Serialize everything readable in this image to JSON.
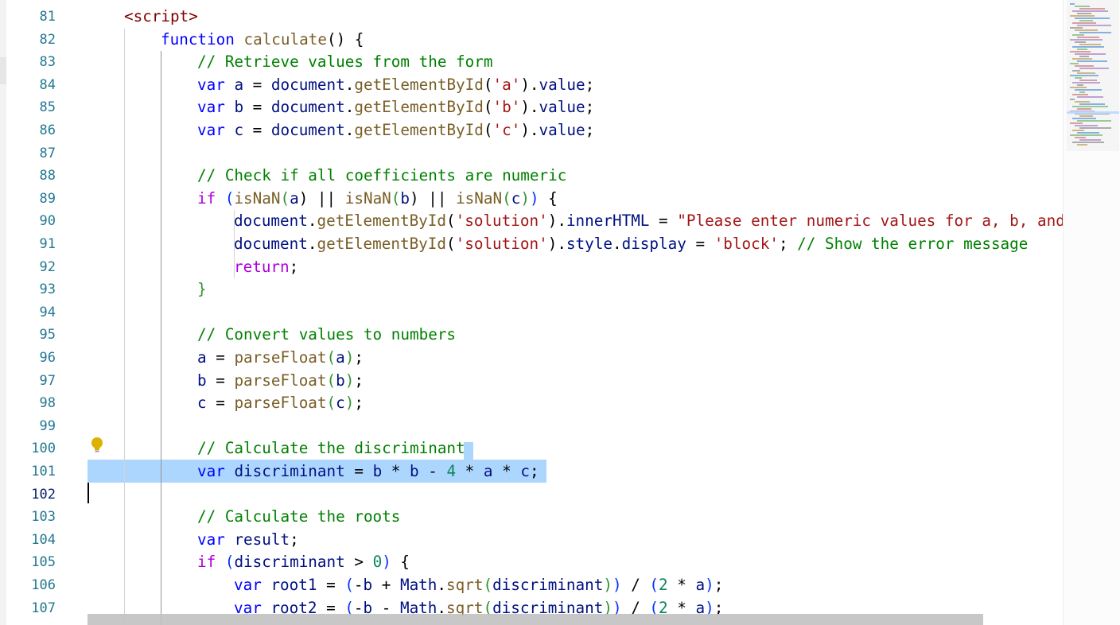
{
  "editor": {
    "active_line": 102,
    "lines": [
      {
        "num": 81,
        "indent": 1,
        "tokens": [
          {
            "t": "<",
            "c": "#800000"
          },
          {
            "t": "script",
            "c": "#800000"
          },
          {
            "t": ">",
            "c": "#800000"
          }
        ]
      },
      {
        "num": 82,
        "indent": 2,
        "tokens": [
          {
            "t": "function ",
            "c": "#0000ff"
          },
          {
            "t": "calculate",
            "c": "#795e26"
          },
          {
            "t": "() {",
            "c": "#000000"
          }
        ]
      },
      {
        "num": 83,
        "indent": 3,
        "tokens": [
          {
            "t": "// Retrieve values from the form",
            "c": "#008000"
          }
        ]
      },
      {
        "num": 84,
        "indent": 3,
        "tokens": [
          {
            "t": "var ",
            "c": "#0000ff"
          },
          {
            "t": "a",
            "c": "#001080"
          },
          {
            "t": " = ",
            "c": "#000000"
          },
          {
            "t": "document",
            "c": "#001080"
          },
          {
            "t": ".",
            "c": "#000000"
          },
          {
            "t": "getElementById",
            "c": "#795e26"
          },
          {
            "t": "(",
            "c": "#000000"
          },
          {
            "t": "'a'",
            "c": "#a31515"
          },
          {
            "t": ").",
            "c": "#000000"
          },
          {
            "t": "value",
            "c": "#001080"
          },
          {
            "t": ";",
            "c": "#000000"
          }
        ]
      },
      {
        "num": 85,
        "indent": 3,
        "tokens": [
          {
            "t": "var ",
            "c": "#0000ff"
          },
          {
            "t": "b",
            "c": "#001080"
          },
          {
            "t": " = ",
            "c": "#000000"
          },
          {
            "t": "document",
            "c": "#001080"
          },
          {
            "t": ".",
            "c": "#000000"
          },
          {
            "t": "getElementById",
            "c": "#795e26"
          },
          {
            "t": "(",
            "c": "#000000"
          },
          {
            "t": "'b'",
            "c": "#a31515"
          },
          {
            "t": ").",
            "c": "#000000"
          },
          {
            "t": "value",
            "c": "#001080"
          },
          {
            "t": ";",
            "c": "#000000"
          }
        ]
      },
      {
        "num": 86,
        "indent": 3,
        "tokens": [
          {
            "t": "var ",
            "c": "#0000ff"
          },
          {
            "t": "c",
            "c": "#001080"
          },
          {
            "t": " = ",
            "c": "#000000"
          },
          {
            "t": "document",
            "c": "#001080"
          },
          {
            "t": ".",
            "c": "#000000"
          },
          {
            "t": "getElementById",
            "c": "#795e26"
          },
          {
            "t": "(",
            "c": "#000000"
          },
          {
            "t": "'c'",
            "c": "#a31515"
          },
          {
            "t": ").",
            "c": "#000000"
          },
          {
            "t": "value",
            "c": "#001080"
          },
          {
            "t": ";",
            "c": "#000000"
          }
        ]
      },
      {
        "num": 87,
        "indent": 3,
        "tokens": []
      },
      {
        "num": 88,
        "indent": 3,
        "tokens": [
          {
            "t": "// Check if all coefficients are numeric",
            "c": "#008000"
          }
        ]
      },
      {
        "num": 89,
        "indent": 3,
        "tokens": [
          {
            "t": "if ",
            "c": "#af00db"
          },
          {
            "t": "(",
            "c": "#0431fa"
          },
          {
            "t": "isNaN",
            "c": "#795e26"
          },
          {
            "t": "(",
            "c": "#319331"
          },
          {
            "t": "a",
            "c": "#001080"
          },
          {
            "t": ") || ",
            "c": "#000000"
          },
          {
            "t": "isNaN",
            "c": "#795e26"
          },
          {
            "t": "(",
            "c": "#319331"
          },
          {
            "t": "b",
            "c": "#001080"
          },
          {
            "t": ") || ",
            "c": "#000000"
          },
          {
            "t": "isNaN",
            "c": "#795e26"
          },
          {
            "t": "(",
            "c": "#319331"
          },
          {
            "t": "c",
            "c": "#001080"
          },
          {
            "t": ")",
            "c": "#319331"
          },
          {
            "t": ")",
            "c": "#0431fa"
          },
          {
            "t": " {",
            "c": "#000000"
          }
        ]
      },
      {
        "num": 90,
        "indent": 4,
        "tokens": [
          {
            "t": "document",
            "c": "#001080"
          },
          {
            "t": ".",
            "c": "#000000"
          },
          {
            "t": "getElementById",
            "c": "#795e26"
          },
          {
            "t": "(",
            "c": "#000000"
          },
          {
            "t": "'solution'",
            "c": "#a31515"
          },
          {
            "t": ").",
            "c": "#000000"
          },
          {
            "t": "innerHTML",
            "c": "#001080"
          },
          {
            "t": " = ",
            "c": "#000000"
          },
          {
            "t": "\"Please enter numeric values for a, b, and",
            "c": "#a31515"
          }
        ]
      },
      {
        "num": 91,
        "indent": 4,
        "tokens": [
          {
            "t": "document",
            "c": "#001080"
          },
          {
            "t": ".",
            "c": "#000000"
          },
          {
            "t": "getElementById",
            "c": "#795e26"
          },
          {
            "t": "(",
            "c": "#000000"
          },
          {
            "t": "'solution'",
            "c": "#a31515"
          },
          {
            "t": ").",
            "c": "#000000"
          },
          {
            "t": "style",
            "c": "#001080"
          },
          {
            "t": ".",
            "c": "#000000"
          },
          {
            "t": "display",
            "c": "#001080"
          },
          {
            "t": " = ",
            "c": "#000000"
          },
          {
            "t": "'block'",
            "c": "#a31515"
          },
          {
            "t": "; ",
            "c": "#000000"
          },
          {
            "t": "// Show the error message",
            "c": "#008000"
          }
        ]
      },
      {
        "num": 92,
        "indent": 4,
        "tokens": [
          {
            "t": "return",
            "c": "#af00db"
          },
          {
            "t": ";",
            "c": "#000000"
          }
        ]
      },
      {
        "num": 93,
        "indent": 3,
        "tokens": [
          {
            "t": "}",
            "c": "#319331"
          }
        ]
      },
      {
        "num": 94,
        "indent": 3,
        "tokens": []
      },
      {
        "num": 95,
        "indent": 3,
        "tokens": [
          {
            "t": "// Convert values to numbers",
            "c": "#008000"
          }
        ]
      },
      {
        "num": 96,
        "indent": 3,
        "tokens": [
          {
            "t": "a",
            "c": "#001080"
          },
          {
            "t": " = ",
            "c": "#000000"
          },
          {
            "t": "parseFloat",
            "c": "#795e26"
          },
          {
            "t": "(",
            "c": "#319331"
          },
          {
            "t": "a",
            "c": "#001080"
          },
          {
            "t": ")",
            "c": "#319331"
          },
          {
            "t": ";",
            "c": "#000000"
          }
        ]
      },
      {
        "num": 97,
        "indent": 3,
        "tokens": [
          {
            "t": "b",
            "c": "#001080"
          },
          {
            "t": " = ",
            "c": "#000000"
          },
          {
            "t": "parseFloat",
            "c": "#795e26"
          },
          {
            "t": "(",
            "c": "#319331"
          },
          {
            "t": "b",
            "c": "#001080"
          },
          {
            "t": ")",
            "c": "#319331"
          },
          {
            "t": ";",
            "c": "#000000"
          }
        ]
      },
      {
        "num": 98,
        "indent": 3,
        "tokens": [
          {
            "t": "c",
            "c": "#001080"
          },
          {
            "t": " = ",
            "c": "#000000"
          },
          {
            "t": "parseFloat",
            "c": "#795e26"
          },
          {
            "t": "(",
            "c": "#319331"
          },
          {
            "t": "c",
            "c": "#001080"
          },
          {
            "t": ")",
            "c": "#319331"
          },
          {
            "t": ";",
            "c": "#000000"
          }
        ]
      },
      {
        "num": 99,
        "indent": 3,
        "tokens": []
      },
      {
        "num": 100,
        "indent": 3,
        "tokens": [
          {
            "t": "// Calculate the discriminant",
            "c": "#008000"
          }
        ]
      },
      {
        "num": 101,
        "indent": 3,
        "tokens": [
          {
            "t": "var ",
            "c": "#0000ff"
          },
          {
            "t": "discriminant",
            "c": "#001080"
          },
          {
            "t": " = ",
            "c": "#000000"
          },
          {
            "t": "b",
            "c": "#001080"
          },
          {
            "t": " * ",
            "c": "#000000"
          },
          {
            "t": "b",
            "c": "#001080"
          },
          {
            "t": " - ",
            "c": "#000000"
          },
          {
            "t": "4",
            "c": "#098658"
          },
          {
            "t": " * ",
            "c": "#000000"
          },
          {
            "t": "a",
            "c": "#001080"
          },
          {
            "t": " * ",
            "c": "#000000"
          },
          {
            "t": "c",
            "c": "#001080"
          },
          {
            "t": ";",
            "c": "#000000"
          }
        ]
      },
      {
        "num": 102,
        "indent": 0,
        "tokens": []
      },
      {
        "num": 103,
        "indent": 3,
        "tokens": [
          {
            "t": "// Calculate the roots",
            "c": "#008000"
          }
        ]
      },
      {
        "num": 104,
        "indent": 3,
        "tokens": [
          {
            "t": "var ",
            "c": "#0000ff"
          },
          {
            "t": "result",
            "c": "#001080"
          },
          {
            "t": ";",
            "c": "#000000"
          }
        ]
      },
      {
        "num": 105,
        "indent": 3,
        "tokens": [
          {
            "t": "if ",
            "c": "#af00db"
          },
          {
            "t": "(",
            "c": "#0431fa"
          },
          {
            "t": "discriminant",
            "c": "#001080"
          },
          {
            "t": " > ",
            "c": "#000000"
          },
          {
            "t": "0",
            "c": "#098658"
          },
          {
            "t": ")",
            "c": "#0431fa"
          },
          {
            "t": " {",
            "c": "#000000"
          }
        ]
      },
      {
        "num": 106,
        "indent": 4,
        "tokens": [
          {
            "t": "var ",
            "c": "#0000ff"
          },
          {
            "t": "root1",
            "c": "#001080"
          },
          {
            "t": " = ",
            "c": "#000000"
          },
          {
            "t": "(",
            "c": "#0431fa"
          },
          {
            "t": "-",
            "c": "#000000"
          },
          {
            "t": "b",
            "c": "#001080"
          },
          {
            "t": " + ",
            "c": "#000000"
          },
          {
            "t": "Math",
            "c": "#001080"
          },
          {
            "t": ".",
            "c": "#000000"
          },
          {
            "t": "sqrt",
            "c": "#795e26"
          },
          {
            "t": "(",
            "c": "#319331"
          },
          {
            "t": "discriminant",
            "c": "#001080"
          },
          {
            "t": ")",
            "c": "#319331"
          },
          {
            "t": ")",
            "c": "#0431fa"
          },
          {
            "t": " / ",
            "c": "#000000"
          },
          {
            "t": "(",
            "c": "#0431fa"
          },
          {
            "t": "2",
            "c": "#098658"
          },
          {
            "t": " * ",
            "c": "#000000"
          },
          {
            "t": "a",
            "c": "#001080"
          },
          {
            "t": ")",
            "c": "#0431fa"
          },
          {
            "t": ";",
            "c": "#000000"
          }
        ]
      },
      {
        "num": 107,
        "indent": 4,
        "tokens": [
          {
            "t": "var ",
            "c": "#0000ff"
          },
          {
            "t": "root2",
            "c": "#001080"
          },
          {
            "t": " = ",
            "c": "#000000"
          },
          {
            "t": "(",
            "c": "#0431fa"
          },
          {
            "t": "-",
            "c": "#000000"
          },
          {
            "t": "b",
            "c": "#001080"
          },
          {
            "t": " - ",
            "c": "#000000"
          },
          {
            "t": "Math",
            "c": "#001080"
          },
          {
            "t": ".",
            "c": "#000000"
          },
          {
            "t": "sqrt",
            "c": "#795e26"
          },
          {
            "t": "(",
            "c": "#319331"
          },
          {
            "t": "discriminant",
            "c": "#001080"
          },
          {
            "t": ")",
            "c": "#319331"
          },
          {
            "t": ")",
            "c": "#0431fa"
          },
          {
            "t": " / ",
            "c": "#000000"
          },
          {
            "t": "(",
            "c": "#0431fa"
          },
          {
            "t": "2",
            "c": "#098658"
          },
          {
            "t": " * ",
            "c": "#000000"
          },
          {
            "t": "a",
            "c": "#001080"
          },
          {
            "t": ")",
            "c": "#0431fa"
          },
          {
            "t": ";",
            "c": "#000000"
          }
        ]
      }
    ]
  },
  "icons": {
    "lightbulb": "lightbulb-icon"
  },
  "colors": {
    "selection": "#add6ff",
    "line_number": "#237893",
    "active_line_number": "#0b216f"
  }
}
